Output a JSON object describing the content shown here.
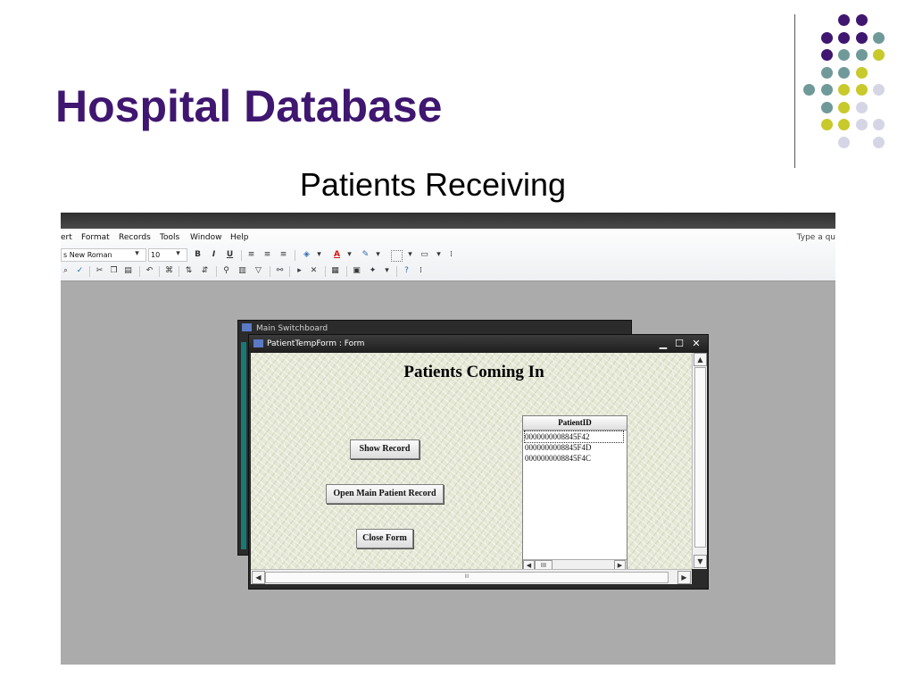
{
  "slide": {
    "title": "Hospital Database",
    "subtitle": "Patients Receiving",
    "title_color": "#3f1670",
    "accent_dots": {
      "purple": "#3f1670",
      "teal": "#6f9a99",
      "olive": "#c8c92b",
      "lavender": "#d6d5e6"
    }
  },
  "access": {
    "menu": [
      "ert",
      "Format",
      "Records",
      "Tools",
      "Window",
      "Help"
    ],
    "help_placeholder": "Type a qu",
    "font_name": "s New Roman",
    "font_size": "10",
    "format_buttons": {
      "bold": "B",
      "italic": "I",
      "underline": "U"
    },
    "back_window_title": "Main Switchboard",
    "form_window": {
      "title": "PatientTempForm : Form",
      "heading": "Patients Coming In",
      "buttons": {
        "show_record": "Show Record",
        "open_main": "Open Main Patient Record",
        "close_form": "Close Form"
      },
      "list": {
        "header": "PatientID",
        "rows": [
          "0000000008845F42",
          "0000000008845F4D",
          "0000000008845F4C"
        ],
        "selected_index": 0
      },
      "scroll_glyph": "III"
    },
    "colors": {
      "titlebar": "#2a2a2a",
      "workspace": "#ababab",
      "teal_strip": "#187a75"
    }
  }
}
